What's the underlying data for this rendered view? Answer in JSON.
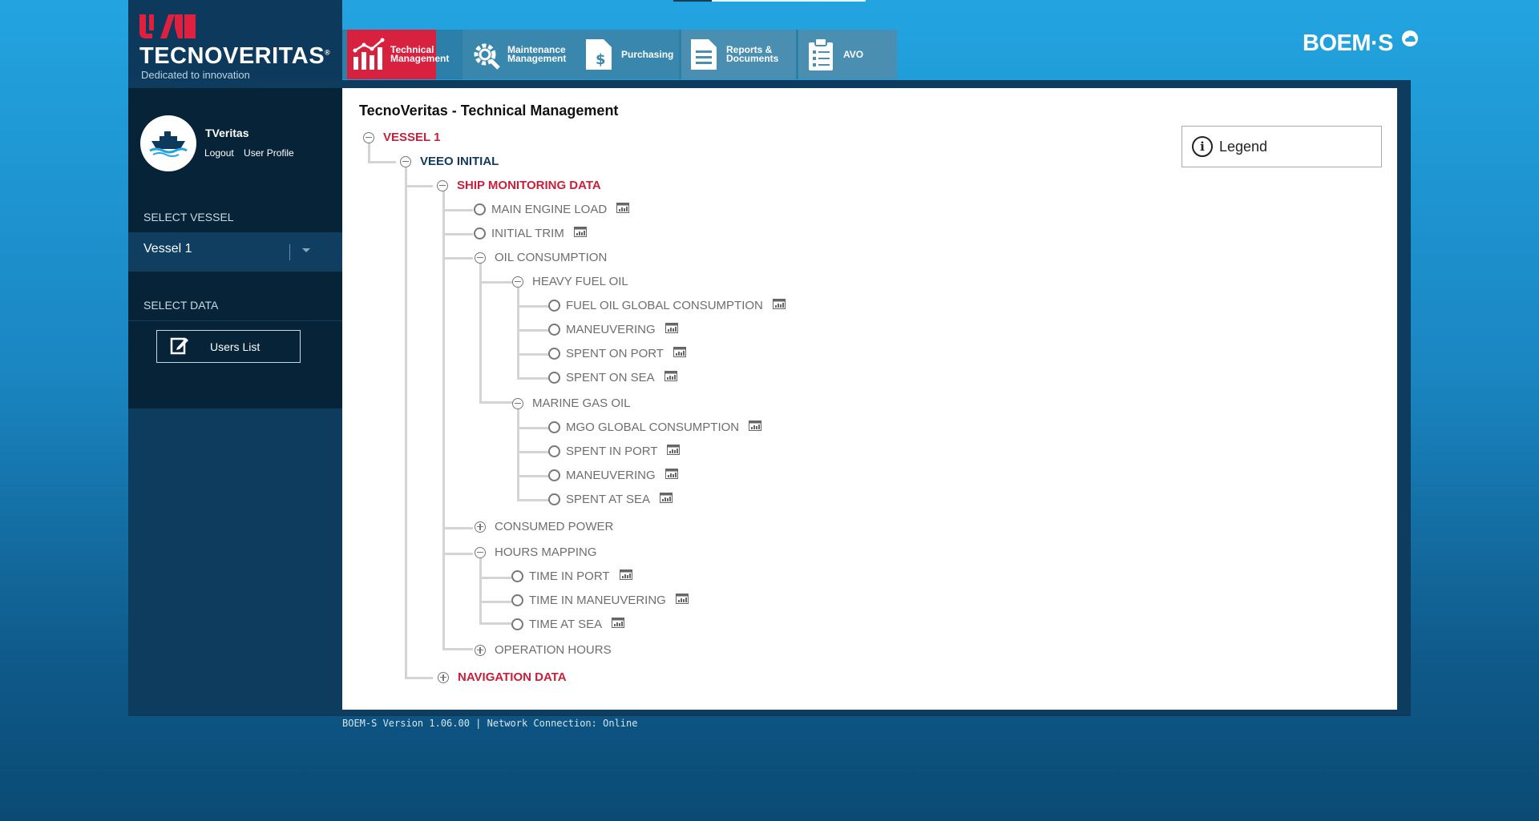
{
  "brand": {
    "logo_text": "TECNOVERITAS",
    "logo_registered": "®",
    "tagline": "Dedicated to innovation",
    "product": "BOEM·S",
    "accent_color": "#d8203f"
  },
  "topnav": {
    "tabs": [
      {
        "line1": "Technical",
        "line2": "Management",
        "icon": "chart-bars-icon",
        "active": true
      },
      {
        "line1": "Maintenance",
        "line2": "Management",
        "icon": "wrench-gear-icon",
        "active": false
      },
      {
        "line1": "Purchasing",
        "line2": "",
        "icon": "dollar-document-icon",
        "active": false
      },
      {
        "line1": "Reports &",
        "line2": "Documents",
        "icon": "document-icon",
        "active": false
      },
      {
        "line1": "AVO",
        "line2": "",
        "icon": "clipboard-checklist-icon",
        "active": false
      }
    ]
  },
  "user": {
    "name": "TVeritas",
    "logout": "Logout",
    "profile": "User Profile",
    "avatar_icon": "ship-icon"
  },
  "sidebar": {
    "select_vessel_label": "SELECT VESSEL",
    "vessel_value": "Vessel 1",
    "select_data_label": "SELECT DATA",
    "users_button": "Users List"
  },
  "panel": {
    "title": "TecnoVeritas - Technical Management",
    "legend": "Legend"
  },
  "tree": {
    "vessel": "VESSEL 1",
    "veeo": "VEEO INITIAL",
    "smd": "SHIP MONITORING DATA",
    "main_engine_load": "MAIN ENGINE LOAD",
    "initial_trim": "INITIAL TRIM",
    "oil_consumption": "OIL CONSUMPTION",
    "heavy_fuel_oil": "HEAVY FUEL OIL",
    "fuel_oil_global": "FUEL OIL GLOBAL CONSUMPTION",
    "hfo_maneuvering": "MANEUVERING",
    "hfo_spent_on_port": "SPENT ON PORT",
    "hfo_spent_on_sea": "SPENT ON SEA",
    "marine_gas_oil": "MARINE GAS OIL",
    "mgo_global": "MGO GLOBAL CONSUMPTION",
    "mgo_spent_in_port": "SPENT IN PORT",
    "mgo_maneuvering": "MANEUVERING",
    "mgo_spent_at_sea": "SPENT AT SEA",
    "consumed_power": "CONSUMED POWER",
    "hours_mapping": "HOURS MAPPING",
    "time_in_port": "TIME IN PORT",
    "time_in_maneuvering": "TIME IN MANEUVERING",
    "time_at_sea": "TIME AT SEA",
    "operation_hours": "OPERATION HOURS",
    "navigation_data": "NAVIGATION DATA"
  },
  "footer": "BOEM-S Version 1.06.00 | Network Connection: Online"
}
